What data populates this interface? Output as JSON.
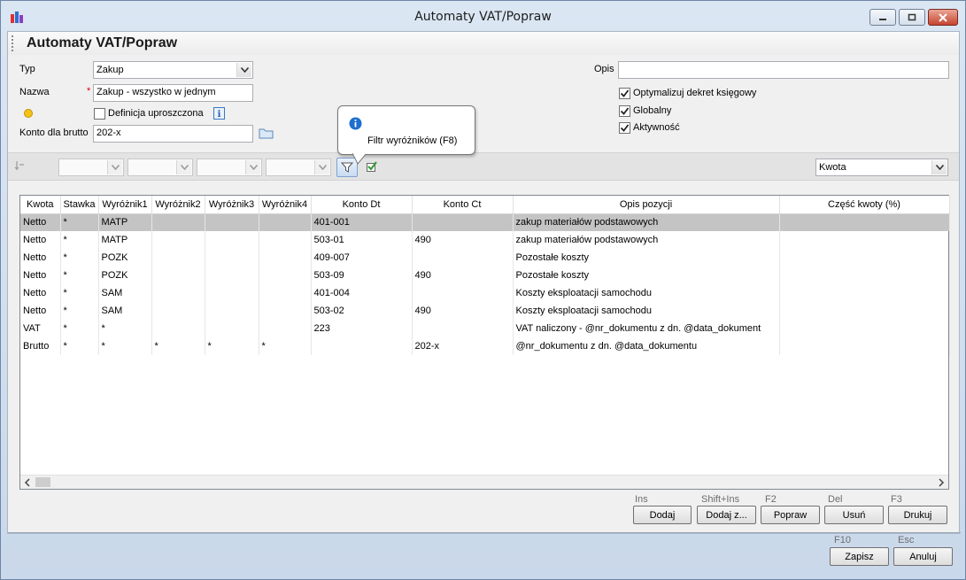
{
  "window": {
    "title": "Automaty VAT/Popraw"
  },
  "page": {
    "title": "Automaty VAT/Popraw"
  },
  "form": {
    "typ_label": "Typ",
    "typ_value": "Zakup",
    "nazwa_label": "Nazwa",
    "nazwa_required": "*",
    "nazwa_value": "Zakup - wszystko w jednym",
    "definicja_label": "Definicja uproszczona",
    "definicja_checked": false,
    "konto_label": "Konto dla brutto",
    "konto_value": "202-x",
    "opis_label": "Opis",
    "opis_value": "",
    "optymalizuj_label": "Optymalizuj dekret księgowy",
    "optymalizuj_checked": true,
    "globalny_label": "Globalny",
    "globalny_checked": true,
    "aktywnosc_label": "Aktywność",
    "aktywnosc_checked": true
  },
  "filterbar": {
    "tooltip": "Filtr wyróżników (F8)",
    "kwota_value": "Kwota"
  },
  "grid": {
    "columns": [
      "Kwota",
      "Stawka",
      "Wyróżnik1",
      "Wyróżnik2",
      "Wyróżnik3",
      "Wyróżnik4",
      "Konto Dt",
      "Konto Ct",
      "Opis pozycji",
      "Część kwoty (%)"
    ],
    "rows": [
      [
        "Netto",
        "*",
        "MATP",
        "",
        "",
        "",
        "401-001",
        "",
        "zakup materiałów podstawowych",
        ""
      ],
      [
        "Netto",
        "*",
        "MATP",
        "",
        "",
        "",
        "503-01",
        "490",
        "zakup materiałów podstawowych",
        ""
      ],
      [
        "Netto",
        "*",
        "POZK",
        "",
        "",
        "",
        "409-007",
        "",
        "Pozostałe koszty",
        ""
      ],
      [
        "Netto",
        "*",
        "POZK",
        "",
        "",
        "",
        "503-09",
        "490",
        "Pozostałe koszty",
        ""
      ],
      [
        "Netto",
        "*",
        "SAM",
        "",
        "",
        "",
        "401-004",
        "",
        "Koszty eksploatacji samochodu",
        ""
      ],
      [
        "Netto",
        "*",
        "SAM",
        "",
        "",
        "",
        "503-02",
        "490",
        "Koszty eksploatacji samochodu",
        ""
      ],
      [
        "VAT",
        "*",
        "*",
        "",
        "",
        "",
        "223",
        "",
        "VAT naliczony - @nr_dokumentu z dn. @data_dokument",
        ""
      ],
      [
        "Brutto",
        "*",
        "*",
        "*",
        "*",
        "*",
        "",
        "202-x",
        "@nr_dokumentu z dn. @data_dokumentu",
        ""
      ]
    ],
    "selected_row": 0
  },
  "actions": {
    "dodaj": {
      "hint": "Ins",
      "label": "Dodaj"
    },
    "dodaj_z": {
      "hint": "Shift+Ins",
      "label": "Dodaj z..."
    },
    "popraw": {
      "hint": "F2",
      "label": "Popraw"
    },
    "usun": {
      "hint": "Del",
      "label": "Usuń"
    },
    "drukuj": {
      "hint": "F3",
      "label": "Drukuj"
    }
  },
  "footer": {
    "zapisz": {
      "hint": "F10",
      "label": "Zapisz"
    },
    "anuluj": {
      "hint": "Esc",
      "label": "Anuluj"
    }
  }
}
